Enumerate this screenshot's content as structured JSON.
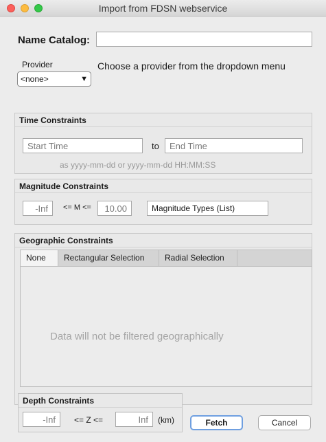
{
  "window": {
    "title": "Import from FDSN webservice"
  },
  "name_catalog": {
    "label": "Name Catalog:",
    "value": ""
  },
  "provider": {
    "label": "Provider",
    "selected": "<none>",
    "hint": "Choose a provider from the dropdown menu"
  },
  "time": {
    "title": "Time Constraints",
    "start_placeholder": "Start Time",
    "to_label": "to",
    "end_placeholder": "End Time",
    "format_hint": "as  yyyy-mm-dd  or  yyyy-mm-dd HH:MM:SS"
  },
  "magnitude": {
    "title": "Magnitude Constraints",
    "min_value": "-Inf",
    "operator_label": "<= M <=",
    "max_value": "10.00",
    "types_value": "Magnitude Types (List)"
  },
  "geographic": {
    "title": "Geographic Constraints",
    "tabs": [
      "None",
      "Rectangular Selection",
      "Radial Selection"
    ],
    "active_tab": "None",
    "message": "Data will not be filtered geographically"
  },
  "depth": {
    "title": "Depth Constraints",
    "min_value": "-Inf",
    "operator_label": "<= Z <=",
    "max_value": "Inf",
    "unit_label": "(km)"
  },
  "buttons": {
    "fetch": "Fetch",
    "cancel": "Cancel"
  }
}
